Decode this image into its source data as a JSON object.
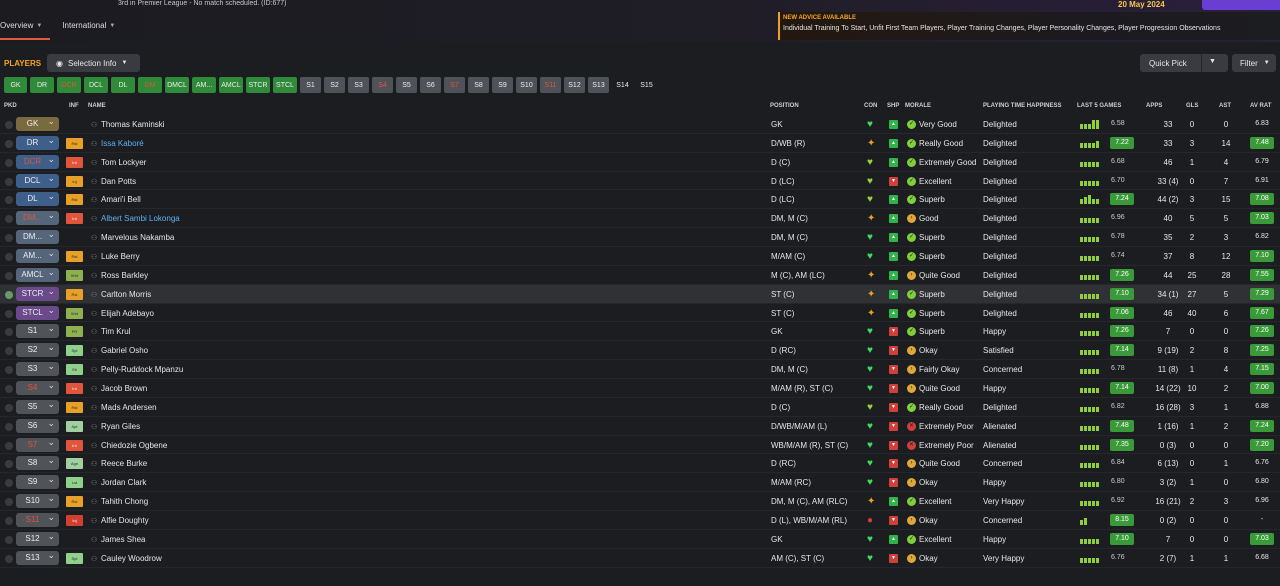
{
  "topbar": {
    "info": "3rd in Premier League - No match scheduled. (ID:677)",
    "date": "20 May 2024"
  },
  "tabs": [
    {
      "label": "Overview"
    },
    {
      "label": "International"
    }
  ],
  "advice": {
    "heading": "NEW ADVICE AVAILABLE",
    "body": "Individual Training To Start, Unfit First Team Players, Player Training Changes, Player Personality Changes, Player Progression Observations"
  },
  "toolbar": {
    "players_label": "PLAYERS",
    "selection_info": "Selection Info",
    "quick_pick": "Quick Pick",
    "filter": "Filter"
  },
  "position_buttons": [
    {
      "label": "GK",
      "style": "g",
      "w": 23
    },
    {
      "label": "DR",
      "style": "g",
      "w": 24
    },
    {
      "label": "DCR",
      "style": "g r",
      "w": 24
    },
    {
      "label": "DCL",
      "style": "g",
      "w": 24
    },
    {
      "label": "DL",
      "style": "g",
      "w": 24
    },
    {
      "label": "DM",
      "style": "g r",
      "w": 24
    },
    {
      "label": "DMCL",
      "style": "g",
      "w": 24
    },
    {
      "label": "AM...",
      "style": "g",
      "w": 24
    },
    {
      "label": "AMCL",
      "style": "g",
      "w": 24
    },
    {
      "label": "STCR",
      "style": "g",
      "w": 24
    },
    {
      "label": "STCL",
      "style": "g",
      "w": 24
    },
    {
      "label": "S1",
      "style": "",
      "w": 21
    },
    {
      "label": "S2",
      "style": "",
      "w": 21
    },
    {
      "label": "S3",
      "style": "",
      "w": 21
    },
    {
      "label": "S4",
      "style": "r",
      "w": 21
    },
    {
      "label": "S5",
      "style": "",
      "w": 21
    },
    {
      "label": "S6",
      "style": "",
      "w": 21
    },
    {
      "label": "S7",
      "style": "r",
      "w": 21
    },
    {
      "label": "S8",
      "style": "",
      "w": 21
    },
    {
      "label": "S9",
      "style": "",
      "w": 21
    },
    {
      "label": "S10",
      "style": "",
      "w": 21
    },
    {
      "label": "S11",
      "style": "r",
      "w": 21
    },
    {
      "label": "S12",
      "style": "",
      "w": 21
    },
    {
      "label": "S13",
      "style": "",
      "w": 21
    },
    {
      "label": "S14",
      "style": "d",
      "w": 21
    },
    {
      "label": "S15",
      "style": "d",
      "w": 21
    }
  ],
  "columns": {
    "pkd": "PKD",
    "inf": "INF",
    "name": "NAME",
    "position": "POSITION",
    "con": "CON",
    "shp": "SHP",
    "morale": "MORALE",
    "pth": "PLAYING TIME HAPPINESS",
    "last5": "LAST 5 GAMES",
    "apps": "APPS",
    "gls": "GLS",
    "ast": "AST",
    "avrat": "AV RAT"
  },
  "colors": {
    "accent": "#f6a623",
    "green": "#2fb34a",
    "red": "#d0403a",
    "link": "#5fb0f0"
  },
  "players": [
    {
      "sel": "GK",
      "selc": "gk",
      "inf": "",
      "infc": "",
      "name": "Thomas Kaminski",
      "lnk": false,
      "pos": "GK",
      "con": "heart-icon",
      "shp": "up",
      "morale_c": "g",
      "morale": "Very Good",
      "pth": "Delighted",
      "bars": [
        5,
        5,
        5,
        9,
        9
      ],
      "rating": "6.58",
      "pill": false,
      "apps": "33",
      "gls": "0",
      "ast": "0",
      "av": "6.83",
      "avpill": false,
      "pk": false
    },
    {
      "sel": "DR",
      "selc": "def",
      "inf": "Rst",
      "infc": "rst",
      "name": "Issa Kaboré",
      "lnk": true,
      "pos": "D/WB (R)",
      "con": "sheriff-badge-icon",
      "shp": "up",
      "morale_c": "g",
      "morale": "Really Good",
      "pth": "Delighted",
      "bars": [
        5,
        5,
        5,
        5,
        7
      ],
      "rating": "7.22",
      "pill": true,
      "apps": "33",
      "gls": "3",
      "ast": "14",
      "av": "7.48",
      "avpill": true,
      "pk": false
    },
    {
      "sel": "DCR",
      "selc": "def red",
      "inf": "Int",
      "infc": "int",
      "name": "Tom Lockyer",
      "lnk": false,
      "pos": "D (C)",
      "con": "half-heart-icon",
      "shp": "up",
      "morale_c": "g",
      "morale": "Extremely Good",
      "pth": "Delighted",
      "bars": [
        5,
        5,
        5,
        5,
        5
      ],
      "rating": "6.68",
      "pill": false,
      "apps": "46",
      "gls": "1",
      "ast": "4",
      "av": "6.79",
      "avpill": false,
      "pk": false
    },
    {
      "sel": "DCL",
      "selc": "def",
      "inf": "Inj",
      "infc": "rst",
      "name": "Dan Potts",
      "lnk": false,
      "pos": "D (LC)",
      "con": "half-heart-icon",
      "shp": "dn",
      "morale_c": "g",
      "morale": "Excellent",
      "pth": "Delighted",
      "bars": [
        5,
        5,
        5,
        5,
        5
      ],
      "rating": "6.70",
      "pill": false,
      "apps": "33 (4)",
      "gls": "0",
      "ast": "7",
      "av": "6.91",
      "avpill": false,
      "pk": false
    },
    {
      "sel": "DL",
      "selc": "def",
      "inf": "Rst",
      "infc": "rst",
      "name": "Amari'i Bell",
      "lnk": false,
      "pos": "D (LC)",
      "con": "half-heart-icon",
      "shp": "up",
      "morale_c": "g",
      "morale": "Superb",
      "pth": "Delighted",
      "bars": [
        5,
        7,
        9,
        5,
        5
      ],
      "rating": "7.24",
      "pill": true,
      "apps": "44 (2)",
      "gls": "3",
      "ast": "15",
      "av": "7.08",
      "avpill": true,
      "pk": false
    },
    {
      "sel": "DM...",
      "selc": "mid red",
      "inf": "Int",
      "infc": "int",
      "name": "Albert Sambi Lokonga",
      "lnk": true,
      "pos": "DM, M (C)",
      "con": "sheriff-badge-icon",
      "shp": "up",
      "morale_c": "y",
      "morale": "Good",
      "pth": "Delighted",
      "bars": [
        5,
        5,
        5,
        5,
        5
      ],
      "rating": "6.96",
      "pill": false,
      "apps": "40",
      "gls": "5",
      "ast": "5",
      "av": "7.03",
      "avpill": true,
      "pk": false
    },
    {
      "sel": "DM...",
      "selc": "mid",
      "inf": "",
      "infc": "",
      "name": "Marvelous Nakamba",
      "lnk": false,
      "pos": "DM, M (C)",
      "con": "heart-icon",
      "shp": "up",
      "morale_c": "g",
      "morale": "Superb",
      "pth": "Delighted",
      "bars": [
        5,
        5,
        5,
        5,
        5
      ],
      "rating": "6.78",
      "pill": false,
      "apps": "35",
      "gls": "2",
      "ast": "3",
      "av": "6.82",
      "avpill": false,
      "pk": false
    },
    {
      "sel": "AM...",
      "selc": "mid",
      "inf": "Rst",
      "infc": "rst",
      "name": "Luke Berry",
      "lnk": false,
      "pos": "M/AM (C)",
      "con": "heart-icon",
      "shp": "up",
      "morale_c": "g",
      "morale": "Superb",
      "pth": "Delighted",
      "bars": [
        5,
        5,
        5,
        5,
        5
      ],
      "rating": "6.74",
      "pill": false,
      "apps": "37",
      "gls": "8",
      "ast": "12",
      "av": "7.10",
      "avpill": true,
      "pk": false
    },
    {
      "sel": "AMCL",
      "selc": "mid",
      "inf": "Wnt",
      "infc": "wnt",
      "name": "Ross Barkley",
      "lnk": false,
      "pos": "M (C), AM (LC)",
      "con": "sheriff-badge-icon",
      "shp": "up",
      "morale_c": "y",
      "morale": "Quite Good",
      "pth": "Delighted",
      "bars": [
        5,
        5,
        5,
        5,
        5
      ],
      "rating": "7.26",
      "pill": true,
      "apps": "44",
      "gls": "25",
      "ast": "28",
      "av": "7.55",
      "avpill": true,
      "pk": false
    },
    {
      "sel": "STCR",
      "selc": "att",
      "inf": "Rst",
      "infc": "rst",
      "name": "Carlton Morris",
      "lnk": false,
      "pos": "ST (C)",
      "con": "sheriff-badge-icon",
      "shp": "up",
      "morale_c": "g",
      "morale": "Superb",
      "pth": "Delighted",
      "bars": [
        5,
        5,
        5,
        5,
        5
      ],
      "rating": "7.10",
      "pill": true,
      "apps": "34 (1)",
      "gls": "27",
      "ast": "5",
      "av": "7.29",
      "avpill": true,
      "pk": true
    },
    {
      "sel": "STCL",
      "selc": "att",
      "inf": "Wnt",
      "infc": "wnt",
      "name": "Elijah Adebayo",
      "lnk": false,
      "pos": "ST (C)",
      "con": "sheriff-badge-icon",
      "shp": "up",
      "morale_c": "g",
      "morale": "Superb",
      "pth": "Delighted",
      "bars": [
        5,
        5,
        5,
        5,
        5
      ],
      "rating": "7.06",
      "pill": true,
      "apps": "46",
      "gls": "40",
      "ast": "6",
      "av": "7.67",
      "avpill": true,
      "pk": false
    },
    {
      "sel": "S1",
      "selc": "",
      "inf": "PR",
      "infc": "pr",
      "name": "Tim Krul",
      "lnk": false,
      "pos": "GK",
      "con": "heart-icon",
      "shp": "dn",
      "morale_c": "g",
      "morale": "Superb",
      "pth": "Happy",
      "bars": [
        5,
        5,
        5,
        5,
        5
      ],
      "rating": "7.26",
      "pill": true,
      "apps": "7",
      "gls": "0",
      "ast": "0",
      "av": "7.26",
      "avpill": true,
      "pk": false
    },
    {
      "sel": "S2",
      "selc": "",
      "inf": "Spt",
      "infc": "spt",
      "name": "Gabriel Osho",
      "lnk": false,
      "pos": "D (RC)",
      "con": "heart-icon",
      "shp": "dn",
      "morale_c": "y",
      "morale": "Okay",
      "pth": "Satisfied",
      "bars": [
        5,
        5,
        5,
        5,
        5
      ],
      "rating": "7.14",
      "pill": true,
      "apps": "9 (19)",
      "gls": "2",
      "ast": "8",
      "av": "7.25",
      "avpill": true,
      "pk": false
    },
    {
      "sel": "S3",
      "selc": "",
      "inf": "Sh",
      "infc": "sh",
      "name": "Pelly-Ruddock Mpanzu",
      "lnk": false,
      "pos": "DM, M (C)",
      "con": "heart-icon",
      "shp": "dn",
      "morale_c": "y",
      "morale": "Fairly Okay",
      "pth": "Concerned",
      "bars": [
        5,
        5,
        5,
        5,
        5
      ],
      "rating": "6.78",
      "pill": false,
      "apps": "11 (8)",
      "gls": "1",
      "ast": "4",
      "av": "7.15",
      "avpill": true,
      "pk": false
    },
    {
      "sel": "S4",
      "selc": "red",
      "inf": "Int",
      "infc": "int",
      "name": "Jacob Brown",
      "lnk": false,
      "pos": "M/AM (R), ST (C)",
      "con": "heart-icon",
      "shp": "dn",
      "morale_c": "y",
      "morale": "Quite Good",
      "pth": "Happy",
      "bars": [
        5,
        5,
        5,
        5,
        5
      ],
      "rating": "7.14",
      "pill": true,
      "apps": "14 (22)",
      "gls": "10",
      "ast": "2",
      "av": "7.00",
      "avpill": true,
      "pk": false
    },
    {
      "sel": "S5",
      "selc": "",
      "inf": "Rst",
      "infc": "rst",
      "name": "Mads Andersen",
      "lnk": false,
      "pos": "D (C)",
      "con": "half-heart-icon",
      "shp": "dn",
      "morale_c": "g",
      "morale": "Really Good",
      "pth": "Delighted",
      "bars": [
        5,
        5,
        5,
        5,
        5
      ],
      "rating": "6.82",
      "pill": false,
      "apps": "16 (28)",
      "gls": "3",
      "ast": "1",
      "av": "6.88",
      "avpill": false,
      "pk": false
    },
    {
      "sel": "S6",
      "selc": "",
      "inf": "Apt",
      "infc": "apt",
      "name": "Ryan Giles",
      "lnk": false,
      "pos": "D/WB/M/AM (L)",
      "con": "heart-icon",
      "shp": "dn",
      "morale_c": "r",
      "morale": "Extremely Poor",
      "pth": "Alienated",
      "bars": [
        5,
        5,
        5,
        5,
        5
      ],
      "rating": "7.48",
      "pill": true,
      "apps": "1 (16)",
      "gls": "1",
      "ast": "2",
      "av": "7.24",
      "avpill": true,
      "pk": false
    },
    {
      "sel": "S7",
      "selc": "red",
      "inf": "Int",
      "infc": "int",
      "name": "Chiedozie Ogbene",
      "lnk": false,
      "pos": "WB/M/AM (R), ST (C)",
      "con": "heart-icon",
      "shp": "dn",
      "morale_c": "r",
      "morale": "Extremely Poor",
      "pth": "Alienated",
      "bars": [
        5,
        5,
        5,
        5,
        5
      ],
      "rating": "7.35",
      "pill": true,
      "apps": "0 (3)",
      "gls": "0",
      "ast": "0",
      "av": "7.20",
      "avpill": true,
      "pk": false
    },
    {
      "sel": "S8",
      "selc": "",
      "inf": "Agn",
      "infc": "apt",
      "name": "Reece Burke",
      "lnk": false,
      "pos": "D (RC)",
      "con": "heart-icon",
      "shp": "dn",
      "morale_c": "y",
      "morale": "Quite Good",
      "pth": "Concerned",
      "bars": [
        5,
        5,
        5,
        5,
        5
      ],
      "rating": "6.84",
      "pill": false,
      "apps": "6 (13)",
      "gls": "0",
      "ast": "1",
      "av": "6.76",
      "avpill": false,
      "pk": false
    },
    {
      "sel": "S9",
      "selc": "",
      "inf": "Lst",
      "infc": "lst",
      "name": "Jordan Clark",
      "lnk": false,
      "pos": "M/AM (RC)",
      "con": "heart-icon",
      "shp": "dn",
      "morale_c": "y",
      "morale": "Okay",
      "pth": "Happy",
      "bars": [
        5,
        5,
        5,
        5,
        5
      ],
      "rating": "6.80",
      "pill": false,
      "apps": "3 (2)",
      "gls": "1",
      "ast": "0",
      "av": "6.80",
      "avpill": false,
      "pk": false
    },
    {
      "sel": "S10",
      "selc": "",
      "inf": "Rst",
      "infc": "rst",
      "name": "Tahith Chong",
      "lnk": false,
      "pos": "DM, M (C), AM (RLC)",
      "con": "sheriff-badge-icon",
      "shp": "up",
      "morale_c": "g",
      "morale": "Excellent",
      "pth": "Very Happy",
      "bars": [
        5,
        5,
        5,
        5,
        5
      ],
      "rating": "6.92",
      "pill": false,
      "apps": "16 (21)",
      "gls": "2",
      "ast": "3",
      "av": "6.96",
      "avpill": false,
      "pk": false
    },
    {
      "sel": "S11",
      "selc": "red",
      "inf": "Inj",
      "infc": "inj",
      "name": "Alfie Doughty",
      "lnk": false,
      "pos": "D (L), WB/M/AM (RL)",
      "con": "injury-dot-icon",
      "shp": "dn",
      "morale_c": "y",
      "morale": "Okay",
      "pth": "Concerned",
      "bars": [
        5,
        7
      ],
      "rating": "8.15",
      "pill": true,
      "apps": "0 (2)",
      "gls": "0",
      "ast": "0",
      "av": "-",
      "avpill": false,
      "pk": false
    },
    {
      "sel": "S12",
      "selc": "",
      "inf": "",
      "infc": "",
      "name": "James Shea",
      "lnk": false,
      "pos": "GK",
      "con": "heart-icon",
      "shp": "up",
      "morale_c": "g",
      "morale": "Excellent",
      "pth": "Happy",
      "bars": [
        5,
        5,
        5,
        5,
        5
      ],
      "rating": "7.10",
      "pill": true,
      "apps": "7",
      "gls": "0",
      "ast": "0",
      "av": "7.03",
      "avpill": true,
      "pk": false
    },
    {
      "sel": "S13",
      "selc": "",
      "inf": "Spt",
      "infc": "spt",
      "name": "Cauley Woodrow",
      "lnk": false,
      "pos": "AM (C), ST (C)",
      "con": "heart-icon",
      "shp": "dn",
      "morale_c": "y",
      "morale": "Okay",
      "pth": "Very Happy",
      "bars": [
        5,
        5,
        5,
        5,
        5
      ],
      "rating": "6.76",
      "pill": false,
      "apps": "2 (7)",
      "gls": "1",
      "ast": "1",
      "av": "6.68",
      "avpill": false,
      "pk": false
    }
  ]
}
